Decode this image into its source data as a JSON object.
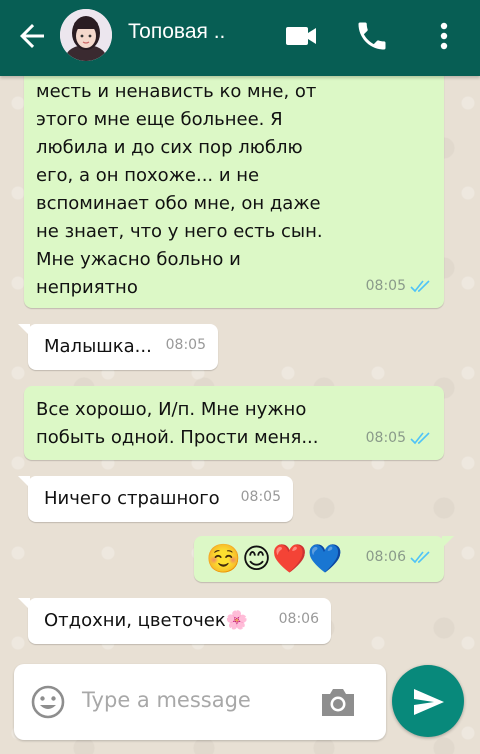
{
  "header": {
    "contact_name": "Топовая ..",
    "icons": [
      "back-arrow-icon",
      "video-call-icon",
      "phone-icon",
      "more-vert-icon"
    ]
  },
  "messages": [
    {
      "direction": "out",
      "text": "месть и ненависть ко мне, от\nэтого мне еще больнее. Я\nлюбила и до сих пор люблю\nего, а он похоже... и не\nвспоминает обо мне, он даже\nне знает, что у него есть сын.\nМне ужасно больно и\nнеприятно",
      "time": "08:05",
      "status": "read"
    },
    {
      "direction": "in",
      "text": "Малышка...",
      "time": "08:05"
    },
    {
      "direction": "out",
      "text": "Все хорошо, И/п. Мне нужно\nпобыть одной. Прости меня...",
      "time": "08:05",
      "status": "read"
    },
    {
      "direction": "in",
      "text": "Ничего страшного",
      "time": "08:05"
    },
    {
      "direction": "out",
      "text": "☺️😊❤️💙",
      "time": "08:06",
      "status": "read"
    },
    {
      "direction": "in",
      "text": "Отдохни, цветочек🌸",
      "time": "08:06"
    }
  ],
  "composer": {
    "placeholder": "Type a message",
    "icons": [
      "emoji-icon",
      "camera-icon",
      "send-icon"
    ]
  },
  "colors": {
    "header": "#075e54",
    "outgoing_bubble": "#dcf8c6",
    "incoming_bubble": "#ffffff",
    "read_tick": "#4fc3f7",
    "send_button": "#08897b"
  }
}
